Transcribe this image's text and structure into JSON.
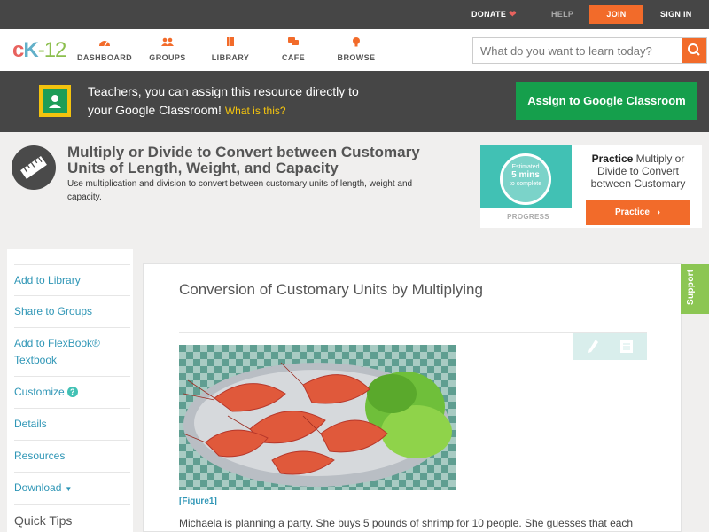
{
  "topbar": {
    "donate": "DONATE",
    "help": "HELP",
    "join": "JOIN",
    "signin": "SIGN IN"
  },
  "logo": {
    "c": "c",
    "k": "K",
    "dash": "-",
    "num": "12"
  },
  "nav": {
    "dashboard": "DASHBOARD",
    "groups": "GROUPS",
    "library": "LIBRARY",
    "cafe": "CAFE",
    "browse": "BROWSE"
  },
  "search": {
    "placeholder": "What do you want to learn today?"
  },
  "banner": {
    "line1": "Teachers, you can assign this resource directly to",
    "line2": "your Google Classroom!",
    "what": "What is this?",
    "assign": "Assign to Google Classroom"
  },
  "concept": {
    "title": "Multiply or Divide to Convert between Customary Units of Length, Weight, and Capacity",
    "description": "Use multiplication and division to convert between customary units of length, weight and capacity."
  },
  "practice": {
    "estimated": "Estimated",
    "mins": "5 mins",
    "complete": "to complete",
    "progress_label": "PROGRESS",
    "bold": "Practice",
    "text": "Multiply or Divide to Convert between Customary",
    "button": "Practice"
  },
  "sidebar": {
    "items": [
      "Add to Library",
      "Share to Groups",
      "Add to FlexBook® Textbook",
      "Customize",
      "Details",
      "Resources",
      "Download"
    ],
    "quick_tips": "Quick Tips"
  },
  "article": {
    "title": "Conversion of Customary Units by Multiplying",
    "figure_caption": "[Figure1]",
    "body": "Michaela is planning a party. She buys 5 pounds of shrimp for 10 people. She guesses that each"
  },
  "support": "Support",
  "colors": {
    "accent_orange": "#f26b2a",
    "google_green": "#159f4c",
    "link_blue": "#2f96b6",
    "support_green": "#8cc653"
  }
}
